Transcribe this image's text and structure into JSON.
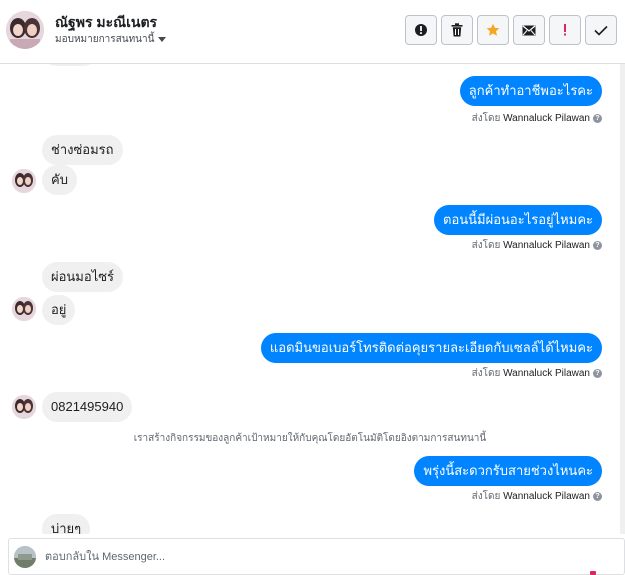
{
  "header": {
    "name": "ณัฐพร มะณีเนตร",
    "assign_label": "มอบหมายการสนทนานี้",
    "actions": [
      {
        "icon": "alert-circle-icon",
        "label": "!"
      },
      {
        "icon": "trash-icon"
      },
      {
        "icon": "star-icon",
        "color": "#f5a623"
      },
      {
        "icon": "envelope-icon"
      },
      {
        "icon": "exclamation-icon",
        "label": "!",
        "color": "#e0245e"
      },
      {
        "icon": "checkmark-icon"
      }
    ]
  },
  "messages": [
    {
      "dir": "out",
      "text": "ลูกค้าทำอาชีพอะไรคะ"
    },
    {
      "dir": "in",
      "text": "ช่างซ่อมรถ"
    },
    {
      "dir": "in",
      "text": "คับ"
    },
    {
      "dir": "out",
      "text": "ตอนนี้มีผ่อนอะไรอยู่ไหมคะ"
    },
    {
      "dir": "in",
      "text": "ผ่อนมอไซร์"
    },
    {
      "dir": "in",
      "text": "อยู่"
    },
    {
      "dir": "out",
      "text": "แอดมินขอเบอร์โทรติดต่อคุยรายละเอียดกับเซลล์ได้ไหมคะ"
    },
    {
      "dir": "in",
      "text": "0821495940"
    },
    {
      "dir": "out",
      "text": "พรุ่งนี้สะดวกรับสายช่วงไหนคะ"
    },
    {
      "dir": "in",
      "text": "บ่ายๆ"
    }
  ],
  "sent_by": {
    "prefix": "ส่งโดย",
    "agent": "Wannaluck Pilawan",
    "help": "?"
  },
  "system_note": "เราสร้างกิจกรรมของลูกค้าเป้าหมายให้กับคุณโดยอัตโนมัติโดยอิงตามการสนทนานี้",
  "composer": {
    "placeholder": "ตอบกลับใน Messenger..."
  },
  "colors": {
    "outgoing_bubble": "#0084ff",
    "incoming_bubble": "#f1f0f0",
    "star": "#f5a623",
    "urgent": "#e0245e"
  }
}
